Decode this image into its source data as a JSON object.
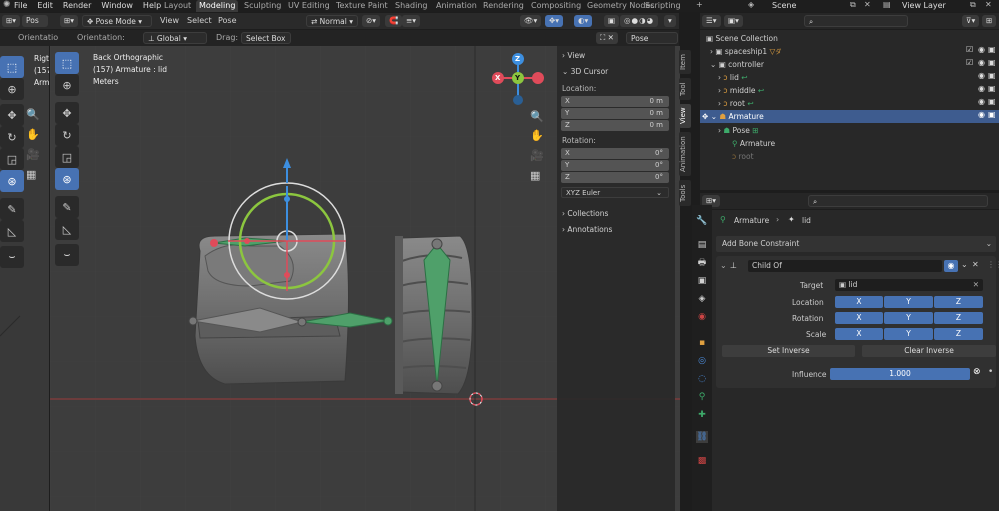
{
  "menu": [
    "File",
    "Edit",
    "Render",
    "Window",
    "Help"
  ],
  "workspaces": [
    "Layout",
    "Modeling",
    "Sculpting",
    "UV Editing",
    "Texture Paint",
    "Shading",
    "Animation",
    "Rendering",
    "Compositing",
    "Geometry Nodes",
    "Scripting"
  ],
  "active_workspace": "Modeling",
  "scene": "Scene",
  "view_layer": "View Layer",
  "header": {
    "mode": "Pose Mode",
    "view": "View",
    "select": "Select",
    "pose": "Pose",
    "shading": "Normal"
  },
  "tool_header": {
    "orientation_label": "Orientation:",
    "orientation_value": "Global",
    "drag_label": "Drag:",
    "drag_value": "Select Box",
    "pose_options": "Pose Options",
    "left_orient": "Orientatio",
    "left_pos": "Pos"
  },
  "viewport": {
    "title": "Back Orthographic",
    "subtitle": "(157) Armature : lid",
    "units": "Meters",
    "left_texts": [
      "Rigt",
      "(157",
      "Arm"
    ]
  },
  "gizmo": {
    "x": "X",
    "y": "Y",
    "z": "Z"
  },
  "n_panel": {
    "view": "View",
    "cursor": "3D Cursor",
    "location": "Location:",
    "rotation": "Rotation:",
    "loc": [
      {
        "axis": "X",
        "val": "0 m"
      },
      {
        "axis": "Y",
        "val": "0 m"
      },
      {
        "axis": "Z",
        "val": "0 m"
      }
    ],
    "rot": [
      {
        "axis": "X",
        "val": "0°"
      },
      {
        "axis": "Y",
        "val": "0°"
      },
      {
        "axis": "Z",
        "val": "0°"
      }
    ],
    "rot_mode": "XYZ Euler",
    "collections": "Collections",
    "annotations": "Annotations"
  },
  "side_tabs": [
    "Item",
    "Tool",
    "View",
    "Animation",
    "Tools"
  ],
  "outliner": {
    "rows": [
      {
        "label": "Scene Collection"
      },
      {
        "label": "spaceship1"
      },
      {
        "label": "controller"
      },
      {
        "label": "lid"
      },
      {
        "label": "middle"
      },
      {
        "label": "root"
      },
      {
        "label": "Armature"
      },
      {
        "label": "Pose"
      },
      {
        "label": "Armature"
      },
      {
        "label": "root"
      }
    ]
  },
  "properties": {
    "breadcrumb_armature": "Armature",
    "breadcrumb_bone": "lid",
    "add_constraint": "Add Bone Constraint",
    "constraint_name": "Child Of",
    "target_label": "Target",
    "target_value": "lid",
    "location_label": "Location",
    "rotation_label": "Rotation",
    "scale_label": "Scale",
    "axes": [
      "X",
      "Y",
      "Z"
    ],
    "set_inverse": "Set Inverse",
    "clear_inverse": "Clear Inverse",
    "influence_label": "Influence",
    "influence_value": "1.000"
  },
  "colors": {
    "accent": "#4772b3",
    "selected_row": "#3e5c8f",
    "x_axis": "#e04b5a",
    "y_axis": "#8cc63f",
    "z_axis": "#3d8fe0",
    "bone_green": "#3daa6a"
  }
}
